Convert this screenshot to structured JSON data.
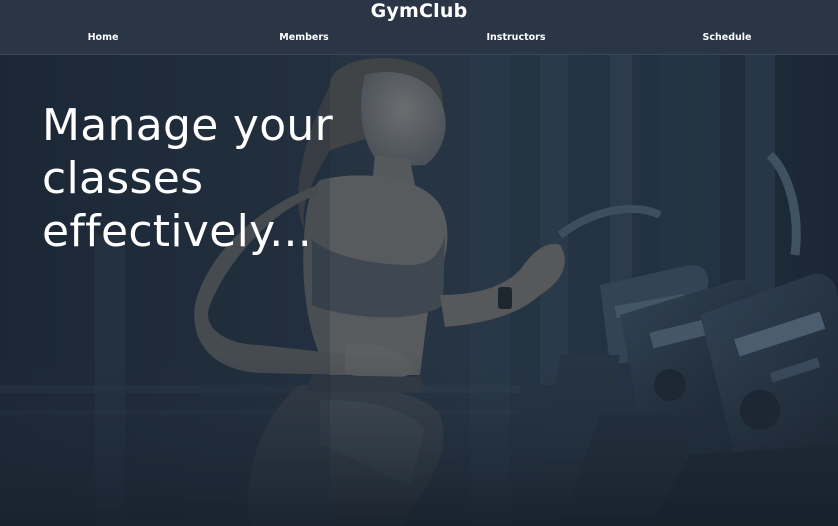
{
  "app": {
    "brand": "GymClub"
  },
  "nav": {
    "home": "Home",
    "members": "Members",
    "instructors": "Instructors",
    "schedule": "Schedule"
  },
  "hero": {
    "line1": "Manage your",
    "line2": "classes",
    "line3": "effectively..."
  },
  "colors": {
    "header_bg": "#2a3646",
    "hero_overlay": "#1f2b39",
    "text": "#ffffff"
  }
}
